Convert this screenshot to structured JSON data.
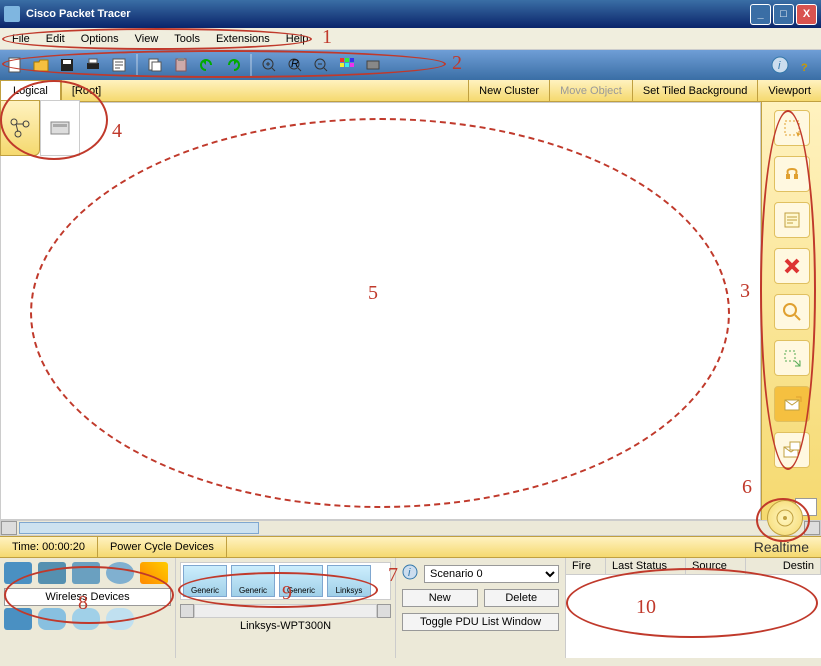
{
  "app": {
    "title": "Cisco Packet Tracer"
  },
  "menu": [
    "File",
    "Edit",
    "Options",
    "View",
    "Tools",
    "Extensions",
    "Help"
  ],
  "toolbar_icons": [
    "new",
    "open",
    "save",
    "print",
    "activity-wizard",
    "copy",
    "paste",
    "undo",
    "redo",
    "zoom-in",
    "zoom-reset",
    "zoom-out",
    "draw-palette",
    "custom-device"
  ],
  "secbar": {
    "tab": "Logical",
    "root": "[Root]",
    "new_cluster": "New Cluster",
    "move_object": "Move Object",
    "set_tiled_bg": "Set Tiled Background",
    "viewport": "Viewport"
  },
  "righttools": [
    "select",
    "move",
    "place-note",
    "delete",
    "inspect",
    "resize",
    "add-simple-pdu",
    "add-complex-pdu"
  ],
  "timebar": {
    "time_label": "Time: 00:00:20",
    "power_cycle": "Power Cycle Devices",
    "realtime": "Realtime"
  },
  "devcats": {
    "row1_icons": [
      "router",
      "switch",
      "hub",
      "wireless",
      "connection"
    ],
    "row2_icons": [
      "end-device",
      "wan",
      "custom",
      "multi"
    ],
    "category_label": "Wireless Devices"
  },
  "devlist": {
    "items": [
      "Generic",
      "Generic",
      "Generic",
      "Linksys"
    ],
    "selected_model": "Linksys-WPT300N"
  },
  "scenario": {
    "selected": "Scenario 0",
    "new": "New",
    "delete": "Delete",
    "toggle": "Toggle PDU List Window"
  },
  "pdu_cols": [
    "Fire",
    "Last Status",
    "Source",
    "Destin"
  ],
  "annotations": [
    "1",
    "2",
    "3",
    "4",
    "5",
    "6",
    "7",
    "8",
    "9",
    "10"
  ]
}
